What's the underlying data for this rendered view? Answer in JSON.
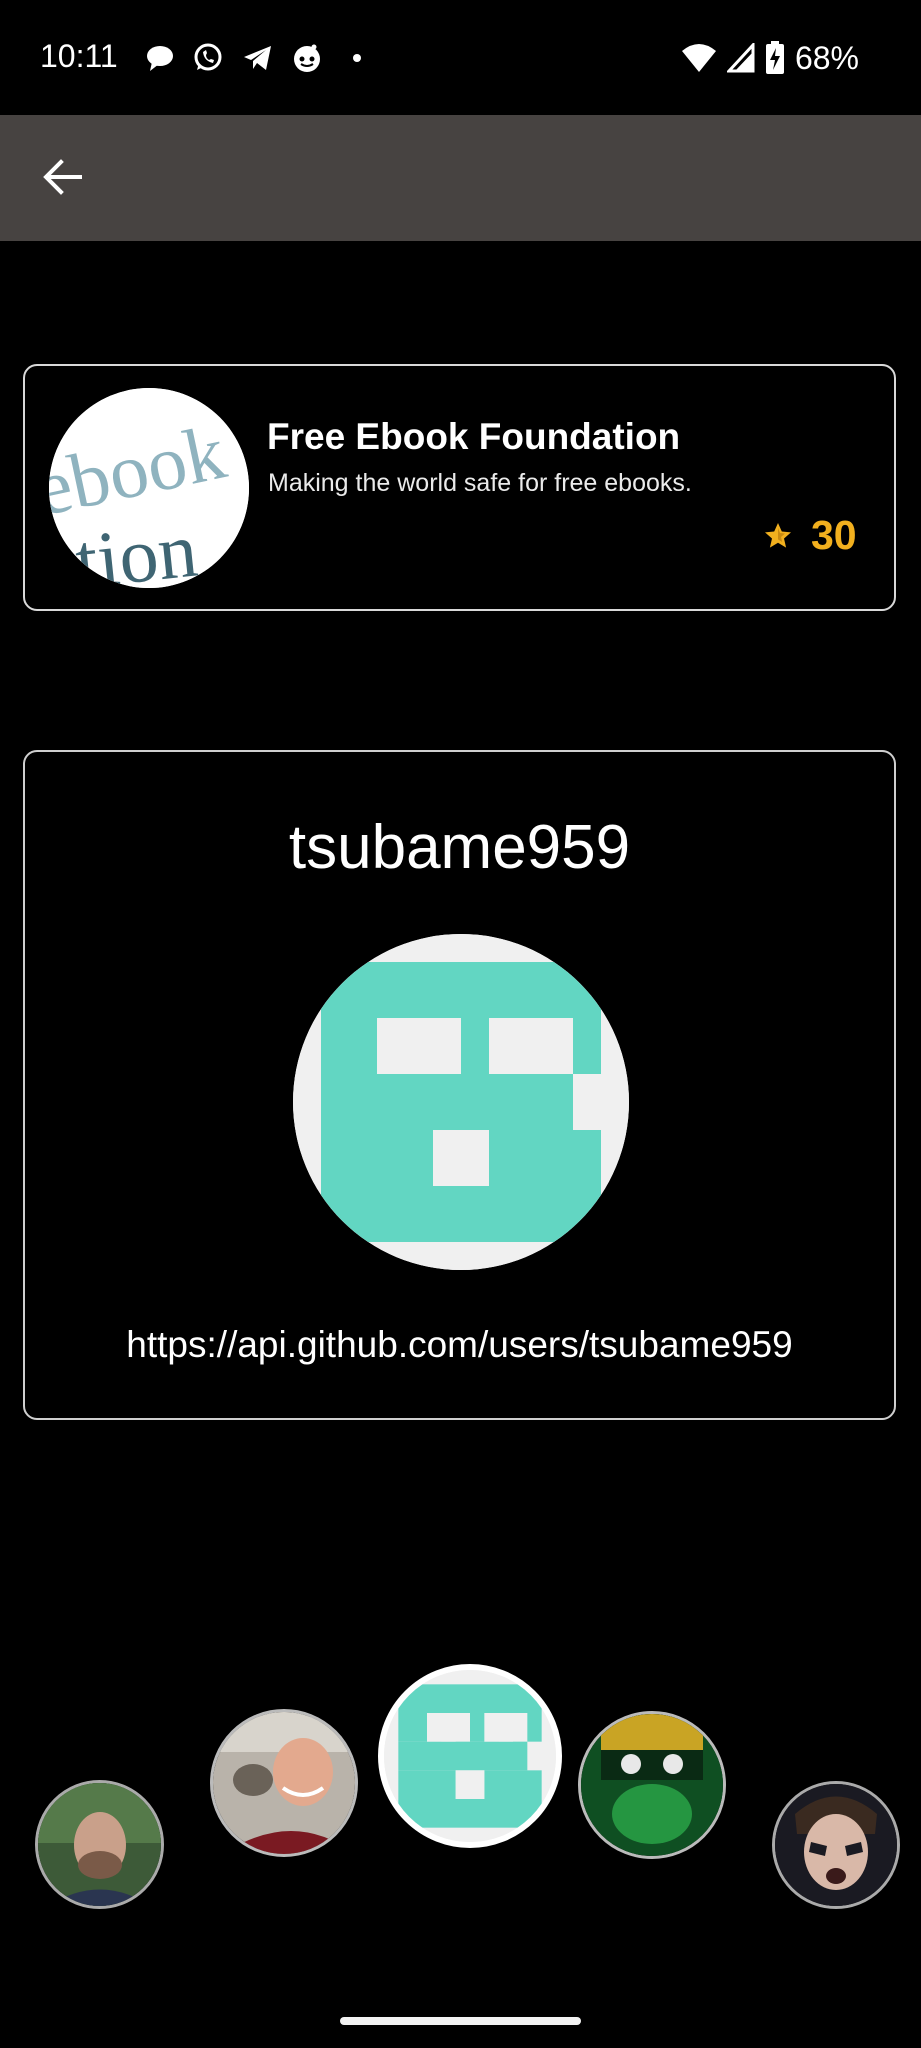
{
  "status_bar": {
    "time": "10:11",
    "battery": "68%",
    "notification_icons": [
      "chat-bubble-icon",
      "whatsapp-icon",
      "telegram-icon",
      "reddit-icon",
      "more-dot-icon"
    ]
  },
  "app_bar": {
    "back_icon": "arrow-left-icon"
  },
  "repo": {
    "name": "Free Ebook Foundation",
    "description": "Making the world safe for free ebooks.",
    "stars": "30",
    "star_color": "#f2b01e"
  },
  "user": {
    "login": "tsubame959",
    "url": "https://api.github.com/users/tsubame959",
    "avatar_color": "#62d6c2"
  },
  "carousel": {
    "selected_index": 2,
    "items": [
      "bearded-man-avatar",
      "smiling-man-avatar",
      "teal-identicon-avatar",
      "green-ninja-avatar",
      "face-paint-avatar"
    ]
  },
  "colors": {
    "background": "#000000",
    "app_bar": "#474341",
    "identicon": "#62d6c2"
  }
}
